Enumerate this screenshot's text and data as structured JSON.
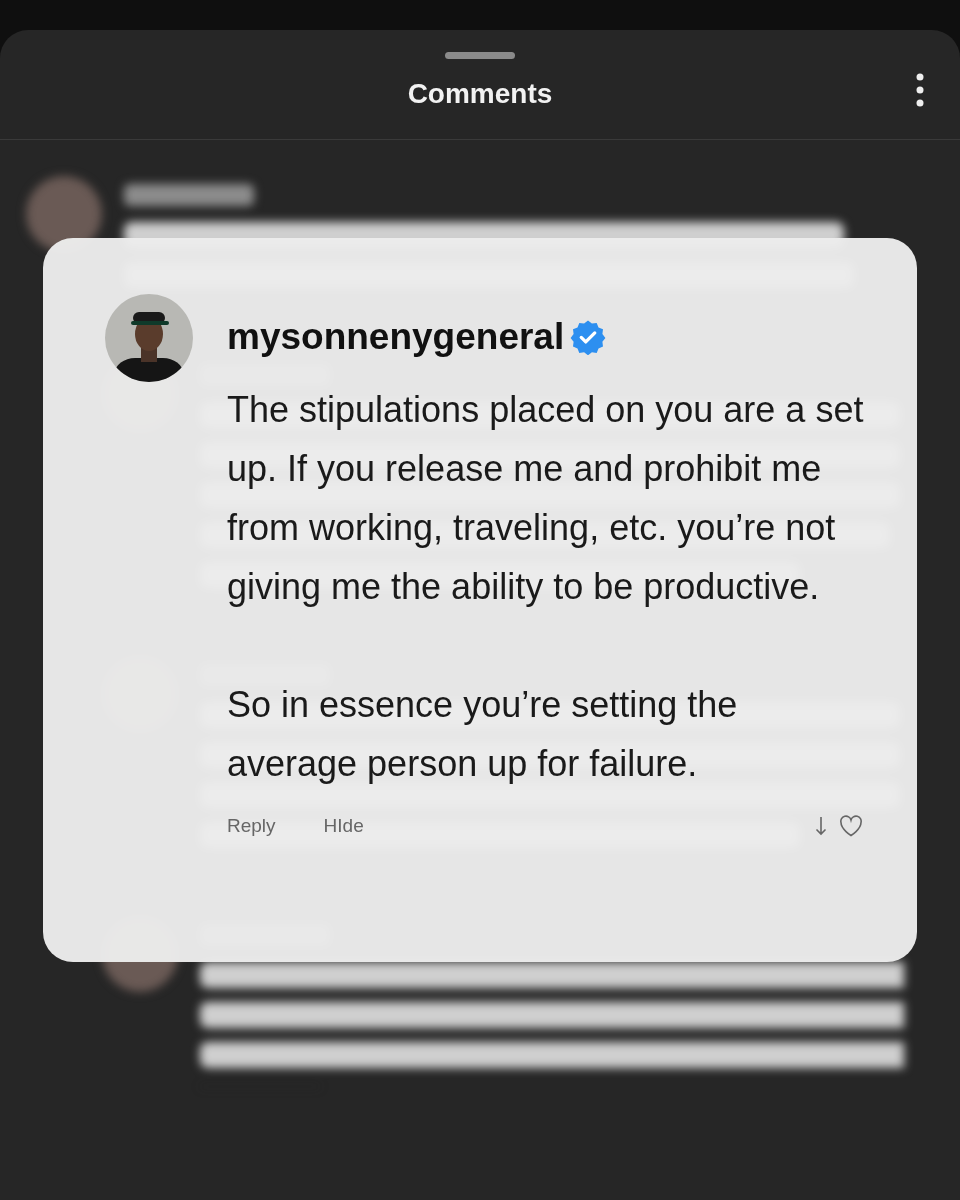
{
  "header": {
    "title": "Comments"
  },
  "highlighted_comment": {
    "username": "mysonnenygeneral",
    "verified": true,
    "paragraphs": [
      "The stipulations placed on you are a set up. If you release me and prohibit me from working, traveling, etc. you’re not giving me the ability to be productive.",
      "So in essence you’re setting the average person up for failure."
    ],
    "actions": [
      "Reply",
      "HIde"
    ],
    "liked": false
  }
}
